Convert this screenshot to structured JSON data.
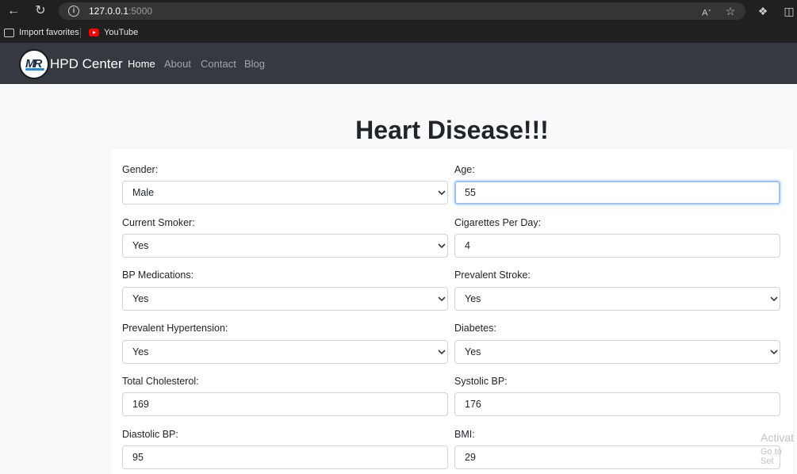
{
  "browser": {
    "url_host": "127.0.0.1",
    "url_port": ":5000",
    "bookmarks": [
      "Import favorites",
      "YouTube"
    ]
  },
  "navbar": {
    "brand": "HPD Center",
    "links": [
      "Home",
      "About",
      "Contact",
      "Blog"
    ],
    "active_link": "Home"
  },
  "page": {
    "title": "Heart Disease!!!"
  },
  "form": {
    "fields": [
      {
        "label": "Gender:",
        "value": "Male",
        "type": "select"
      },
      {
        "label": "Age:",
        "value": "55",
        "type": "input"
      },
      {
        "label": "Current Smoker:",
        "value": "Yes",
        "type": "select"
      },
      {
        "label": "Cigarettes Per Day:",
        "value": "4",
        "type": "input"
      },
      {
        "label": "BP Medications:",
        "value": "Yes",
        "type": "select"
      },
      {
        "label": "Prevalent Stroke:",
        "value": "Yes",
        "type": "select"
      },
      {
        "label": "Prevalent Hypertension:",
        "value": "Yes",
        "type": "select"
      },
      {
        "label": "Diabetes:",
        "value": "Yes",
        "type": "select"
      },
      {
        "label": "Total Cholesterol:",
        "value": "169",
        "type": "input"
      },
      {
        "label": "Systolic BP:",
        "value": "176",
        "type": "input"
      },
      {
        "label": "Diastolic BP:",
        "value": "95",
        "type": "input"
      },
      {
        "label": "BMI:",
        "value": "29",
        "type": "input"
      }
    ]
  },
  "watermark": {
    "line1": "Activat",
    "line2": "Go to Set"
  }
}
